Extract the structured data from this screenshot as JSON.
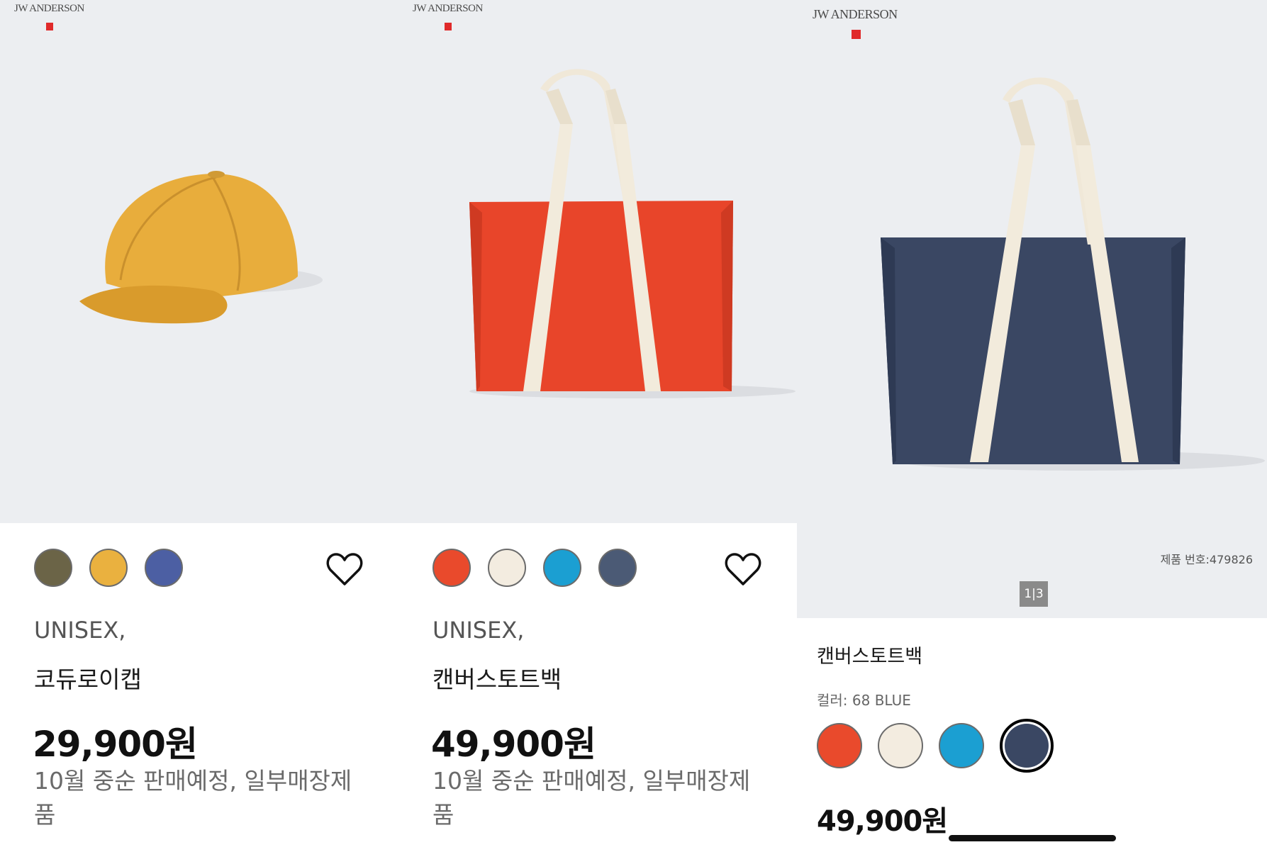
{
  "panels": [
    {
      "brand": "JW ANDERSON",
      "swatches": [
        "#6b6447",
        "#eab13f",
        "#4c5fa3"
      ],
      "gender": "UNISEX,",
      "name": "코듀로이캡",
      "price": "29,900원",
      "note": "10월 중순 판매예정, 일부매장제품",
      "icon": "heart-icon"
    },
    {
      "brand": "JW ANDERSON",
      "swatches": [
        "#e94a2c",
        "#f3ece0",
        "#1b9fd2",
        "#4b5a75"
      ],
      "gender": "UNISEX,",
      "name": "캔버스토트백",
      "price": "49,900원",
      "note": "10월 중순 판매예정, 일부매장제품",
      "icon": "heart-icon"
    }
  ],
  "detail": {
    "brand": "JW ANDERSON",
    "product_no": "제품 번호:479826",
    "pager": "1|3",
    "name": "캔버스토트백",
    "color_label": "컬러: 68 BLUE",
    "swatches": [
      "#e94a2c",
      "#f3ece0",
      "#1b9fd2",
      "#3a4763"
    ],
    "selected_swatch": 3,
    "price": "49,900원"
  }
}
